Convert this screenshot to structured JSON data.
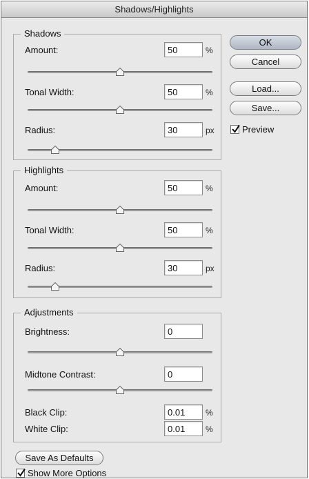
{
  "window": {
    "title": "Shadows/Highlights"
  },
  "buttons": {
    "ok": "OK",
    "cancel": "Cancel",
    "load": "Load...",
    "save": "Save...",
    "save_defaults": "Save As Defaults"
  },
  "preview": {
    "label": "Preview",
    "checked": true
  },
  "show_more": {
    "label": "Show More Options",
    "checked": true
  },
  "shadows": {
    "title": "Shadows",
    "amount": {
      "label": "Amount:",
      "value": "50",
      "unit": "%",
      "slider": 0.5
    },
    "tonal_width": {
      "label": "Tonal Width:",
      "value": "50",
      "unit": "%",
      "slider": 0.5
    },
    "radius": {
      "label": "Radius:",
      "value": "30",
      "unit": "px",
      "slider": 0.15
    }
  },
  "highlights": {
    "title": "Highlights",
    "amount": {
      "label": "Amount:",
      "value": "50",
      "unit": "%",
      "slider": 0.5
    },
    "tonal_width": {
      "label": "Tonal Width:",
      "value": "50",
      "unit": "%",
      "slider": 0.5
    },
    "radius": {
      "label": "Radius:",
      "value": "30",
      "unit": "px",
      "slider": 0.15
    }
  },
  "adjustments": {
    "title": "Adjustments",
    "brightness": {
      "label": "Brightness:",
      "value": "0",
      "slider": 0.5
    },
    "midtone_contrast": {
      "label": "Midtone Contrast:",
      "value": "0",
      "slider": 0.5
    },
    "black_clip": {
      "label": "Black Clip:",
      "value": "0.01",
      "unit": "%"
    },
    "white_clip": {
      "label": "White Clip:",
      "value": "0.01",
      "unit": "%"
    }
  }
}
